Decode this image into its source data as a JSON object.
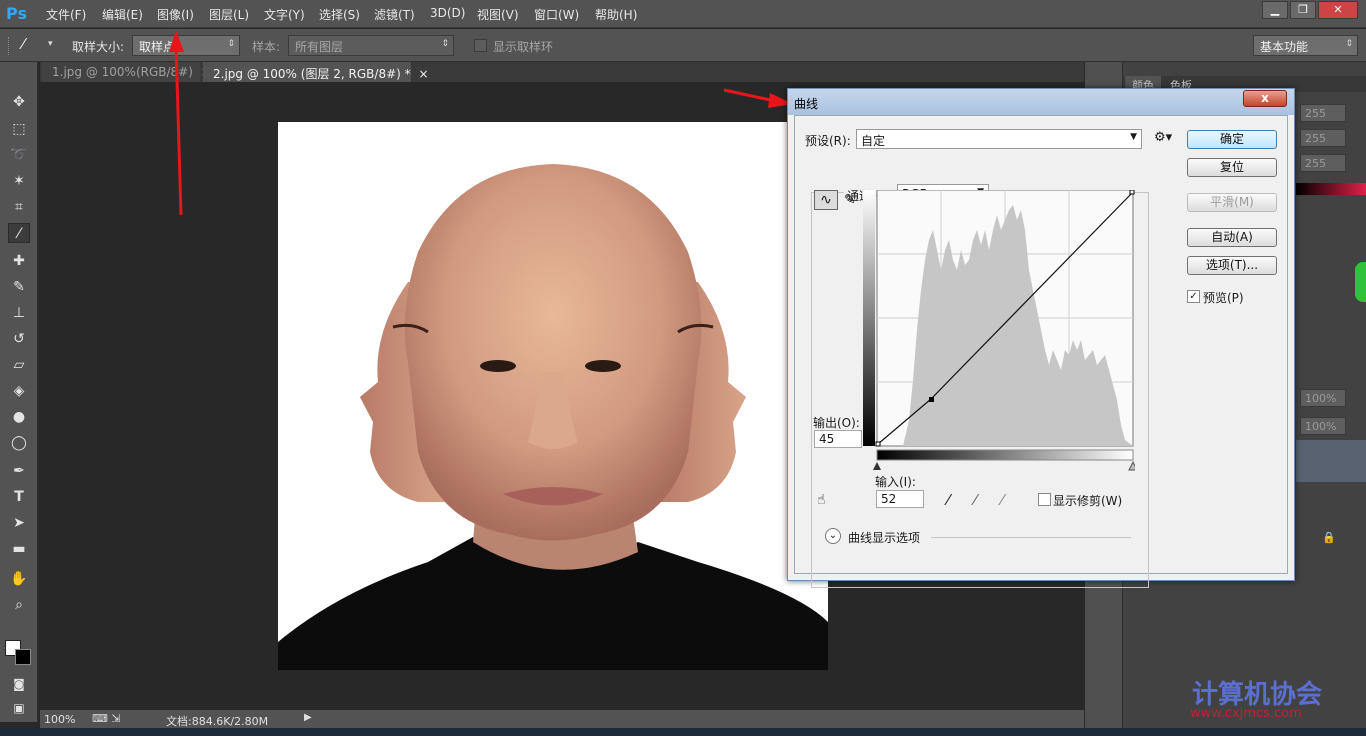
{
  "app": {
    "logo": "Ps"
  },
  "menu": [
    "文件(F)",
    "编辑(E)",
    "图像(I)",
    "图层(L)",
    "文字(Y)",
    "选择(S)",
    "滤镜(T)",
    "3D(D)",
    "视图(V)",
    "窗口(W)",
    "帮助(H)"
  ],
  "window_controls": {
    "minimize": "▁",
    "restore": "❐",
    "close": "✕"
  },
  "options": {
    "sample_size_label": "取样大小:",
    "sample_size_value": "取样点",
    "sample_label": "样本:",
    "sample_value": "所有图层",
    "show_ring_label": "显示取样环",
    "workspace": "基本功能"
  },
  "tabs": [
    {
      "label": "1.jpg @ 100%(RGB/8#)",
      "close": "×"
    },
    {
      "label": "2.jpg @ 100% (图层 2, RGB/8#) *",
      "close": "×"
    }
  ],
  "status": {
    "zoom": "100%",
    "doc_info": "文档:884.6K/2.80M"
  },
  "right_panel": {
    "tabs": [
      "颜色",
      "色板"
    ],
    "fields": [
      "255",
      "255",
      "255"
    ],
    "opacity_fields": [
      "100%",
      "100%"
    ]
  },
  "curves": {
    "title": "曲线",
    "close": "x",
    "preset_label": "预设(R):",
    "preset_value": "自定",
    "channel_label": "通道(C):",
    "channel_value": "RGB",
    "output_label": "输出(O):",
    "output_value": "45",
    "input_label": "输入(I):",
    "input_value": "52",
    "show_clipping_label": "显示修剪(W)",
    "display_options_label": "曲线显示选项",
    "preview_label": "预览(P)",
    "preview_checked": "✓",
    "buttons": {
      "ok": "确定",
      "reset": "复位",
      "smooth": "平滑(M)",
      "auto": "自动(A)",
      "options": "选项(T)..."
    }
  },
  "watermark": {
    "text": "计算机协会",
    "url": "www.cxjmcs.com"
  },
  "colors": {
    "ui_dark": "#282828",
    "ui_panel": "#535353",
    "dialog_bg": "#f0f0f0",
    "titlebar": "#b7cbe6",
    "close_red": "#c4442c",
    "annotation_red": "#e8161b",
    "watermark_blue": "#5b6fd0"
  }
}
